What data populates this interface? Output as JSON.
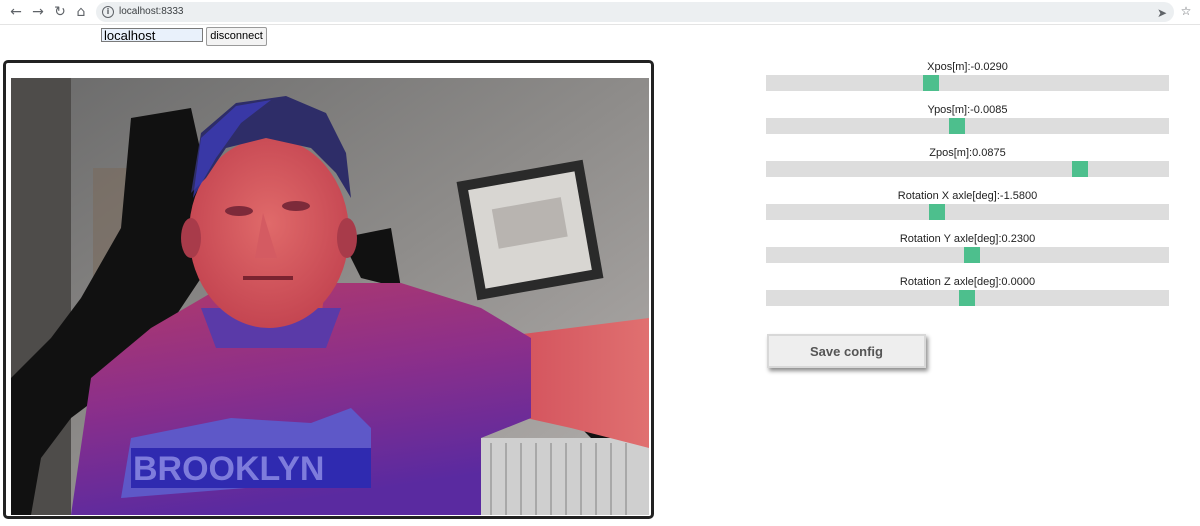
{
  "browser": {
    "url": "localhost:8333",
    "back_icon": "arrow-left-icon",
    "forward_icon": "arrow-right-icon",
    "reload_icon": "reload-icon",
    "home_icon": "home-icon",
    "info_icon": "info-icon",
    "send_icon": "send-icon",
    "star_icon": "star-icon"
  },
  "connection": {
    "host_value": "localhost",
    "disconnect_label": "disconnect"
  },
  "sliders": [
    {
      "label": "Xpos[m]:-0.0290",
      "fraction": 0.41
    },
    {
      "label": "Ypos[m]:-0.0085",
      "fraction": 0.475
    },
    {
      "label": "Zpos[m]:0.0875",
      "fraction": 0.78
    },
    {
      "label": "Rotation X axle[deg]:-1.5800",
      "fraction": 0.425
    },
    {
      "label": "Rotation Y axle[deg]:0.2300",
      "fraction": 0.512
    },
    {
      "label": "Rotation Z axle[deg]:0.0000",
      "fraction": 0.498
    }
  ],
  "save_button": {
    "label": "Save config"
  },
  "colors": {
    "slider_thumb": "#4dbf8d",
    "slider_track": "#dddddd",
    "video_border": "#222222"
  }
}
